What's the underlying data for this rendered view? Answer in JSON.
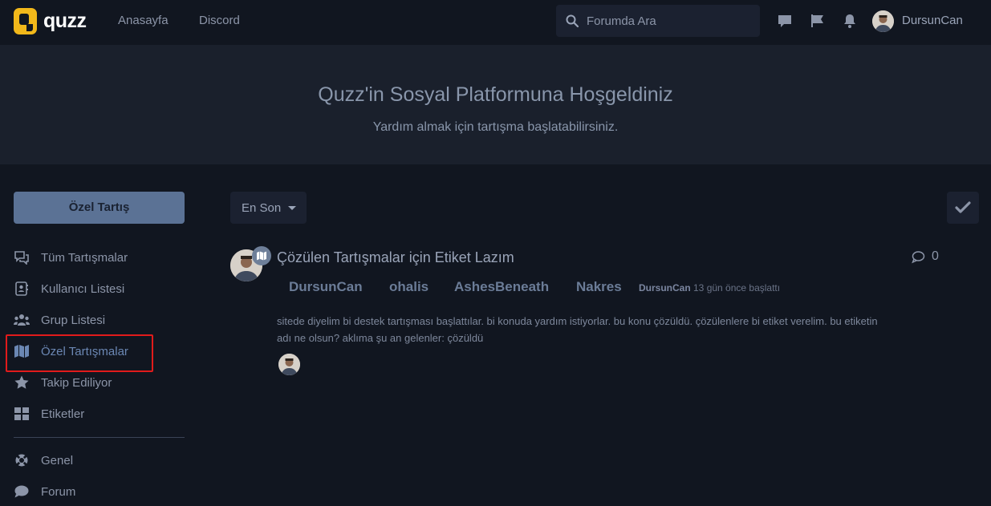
{
  "header": {
    "logo_text": "quzz",
    "nav": [
      "Anasayfa",
      "Discord"
    ],
    "search_placeholder": "Forumda Ara",
    "username": "DursunCan"
  },
  "hero": {
    "title": "Quzz'in Sosyal Platformuna Hoşgeldiniz",
    "subtitle": "Yardım almak için tartışma başlatabilirsiniz."
  },
  "sidebar": {
    "new_button": "Özel Tartış",
    "items": [
      {
        "label": "Tüm Tartışmalar",
        "icon": "comments-icon"
      },
      {
        "label": "Kullanıcı Listesi",
        "icon": "address-book-icon"
      },
      {
        "label": "Grup Listesi",
        "icon": "users-icon"
      },
      {
        "label": "Özel Tartışmalar",
        "icon": "map-icon",
        "active": true
      },
      {
        "label": "Takip Ediliyor",
        "icon": "star-icon"
      },
      {
        "label": "Etiketler",
        "icon": "grid-icon"
      }
    ],
    "tags": [
      {
        "label": "Genel",
        "icon": "lifebuoy-icon"
      },
      {
        "label": "Forum",
        "icon": "comment-icon"
      }
    ]
  },
  "toolbar": {
    "sort_label": "En Son"
  },
  "discussion": {
    "title": "Çözülen Tartışmalar için Etiket Lazım",
    "reply_count": "0",
    "recipients": [
      "DursunCan",
      "ohalis",
      "AshesBeneath",
      "Nakres"
    ],
    "meta_user": "DursunCan",
    "meta_time": " 13 gün önce başlattı",
    "excerpt": "sitede diyelim bi destek tartışması başlattılar. bi konuda yardım istiyorlar. bu konu çözüldü. çözülenlere bi etiket verelim. bu etiketin adı ne olsun? aklıma şu an gelenler: çözüldü"
  },
  "colors": {
    "background": "#111620",
    "hero": "#1a202c",
    "accent": "#5b7295",
    "logo": "#f2b81a",
    "highlight": "#e11b1b"
  }
}
